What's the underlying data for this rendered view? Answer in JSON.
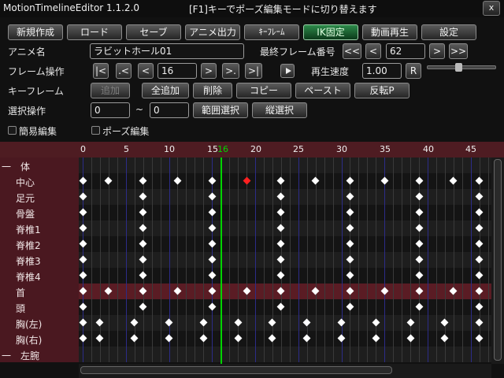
{
  "app": {
    "title": "MotionTimelineEditor 1.1.2.0",
    "hint": "[F1]キーでポーズ編集モードに切り替えます",
    "close_label": "x"
  },
  "toolbar": {
    "new_label": "新規作成",
    "load_label": "ロード",
    "save_label": "セーブ",
    "export_label": "アニメ出力",
    "keyframe_label": "ｷｰﾌﾚｰﾑ",
    "ik_fixed_label": "IK固定",
    "video_play_label": "動画再生",
    "settings_label": "設定"
  },
  "anime": {
    "name_label": "アニメ名",
    "name_value": "ラビットホール01",
    "last_frame_label": "最終フレーム番号",
    "last_frame_first": "<<",
    "last_frame_prev": "<",
    "last_frame_value": "62",
    "last_frame_next": ">",
    "last_frame_last": ">>"
  },
  "frame_ops": {
    "label": "フレーム操作",
    "first": "|<",
    "prev_key": ".<",
    "prev": "<",
    "frame_value": "16",
    "next": ">",
    "next_key": ">.",
    "last": ">|",
    "play_speed_label": "再生速度",
    "play_speed_value": "1.00",
    "reset_label": "R",
    "play_speed_fraction": 0.45
  },
  "keyframe_ops": {
    "label": "キーフレーム",
    "add": "追加",
    "add_all": "全追加",
    "delete": "削除",
    "copy": "コピー",
    "paste": "ペースト",
    "flip": "反転P"
  },
  "selection": {
    "label": "選択操作",
    "from_value": "0",
    "tilde": "~",
    "to_value": "0",
    "range_select": "範囲選択",
    "vertical_select": "縦選択"
  },
  "options": {
    "simple_edit": "簡易編集",
    "pose_edit": "ポーズ編集"
  },
  "timeline": {
    "ruler_labels": [
      "0",
      "5",
      "10",
      "15",
      "20",
      "25",
      "30",
      "35",
      "40",
      "45"
    ],
    "current_frame_label": "16",
    "current_frame": 16,
    "group_body": "一　体",
    "group_left_arm": "一　左腕",
    "rows": [
      {
        "name": "中心",
        "frames": [
          0,
          3,
          7,
          11,
          15,
          19,
          23,
          27,
          31,
          35,
          39,
          43,
          46
        ],
        "red_frames": [
          19
        ]
      },
      {
        "name": "足元",
        "frames": [
          0,
          7,
          15,
          23,
          31,
          39,
          46
        ],
        "red_frames": []
      },
      {
        "name": "骨盤",
        "frames": [
          0,
          7,
          15,
          23,
          31,
          39,
          46
        ],
        "red_frames": []
      },
      {
        "name": "脊椎1",
        "frames": [
          0,
          7,
          15,
          23,
          31,
          39,
          46
        ],
        "red_frames": []
      },
      {
        "name": "脊椎2",
        "frames": [
          0,
          7,
          15,
          23,
          31,
          39,
          46
        ],
        "red_frames": []
      },
      {
        "name": "脊椎3",
        "frames": [
          0,
          7,
          15,
          23,
          31,
          39,
          46
        ],
        "red_frames": []
      },
      {
        "name": "脊椎4",
        "frames": [
          0,
          7,
          15,
          23,
          31,
          39,
          46
        ],
        "red_frames": []
      },
      {
        "name": "首",
        "frames": [
          0,
          3,
          7,
          11,
          15,
          19,
          23,
          27,
          31,
          35,
          39,
          43,
          46
        ],
        "red_frames": []
      },
      {
        "name": "頭",
        "frames": [
          0,
          7,
          15,
          23,
          31,
          39,
          46
        ],
        "red_frames": []
      },
      {
        "name": "胸(左)",
        "frames": [
          0,
          2,
          6,
          10,
          14,
          18,
          22,
          26,
          30,
          34,
          38,
          42,
          46
        ],
        "red_frames": []
      },
      {
        "name": "胸(右)",
        "frames": [
          0,
          2,
          6,
          10,
          14,
          18,
          22,
          26,
          30,
          34,
          38,
          42,
          46
        ],
        "red_frames": []
      }
    ],
    "selected_row": "首",
    "colors": {
      "ruler": "#4e1c22",
      "cursor": "#00d400",
      "grid_line": "#3a3a3a",
      "grid_line_5": "#2c2c88",
      "selected_row": "#5a1c24"
    }
  }
}
